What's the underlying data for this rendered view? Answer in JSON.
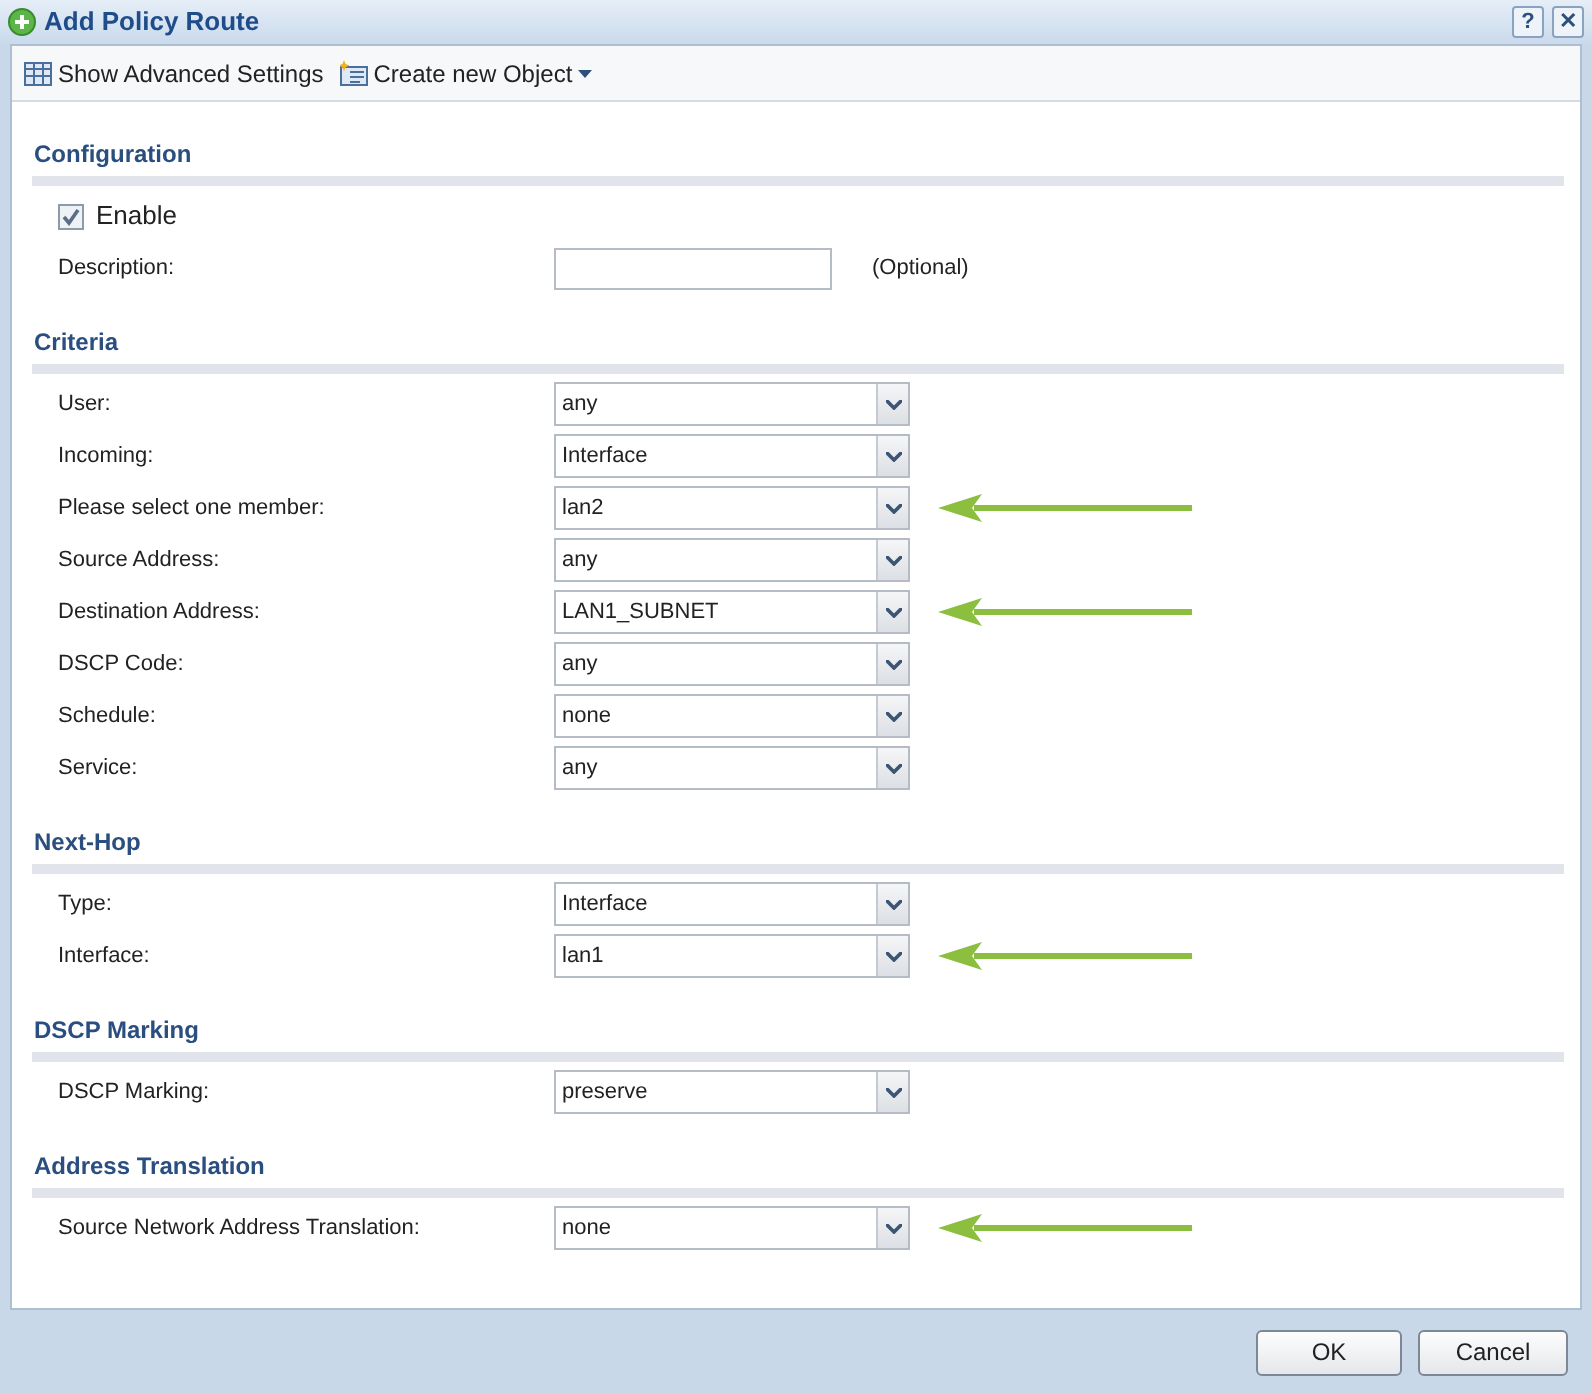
{
  "window": {
    "title": "Add Policy Route",
    "buttons": [
      "?",
      "✕"
    ]
  },
  "toolbar": [
    {
      "label": "Show Advanced Settings",
      "kind": "table"
    },
    {
      "label": "Create new Object",
      "kind": "object",
      "dropdown": true
    }
  ],
  "sections": [
    {
      "title": "Configuration",
      "rows": [
        {
          "kind": "checkbox",
          "label": "Enable",
          "checked": true
        },
        {
          "kind": "text",
          "label": "Description:",
          "hint": "(Optional)"
        }
      ]
    },
    {
      "title": "Criteria",
      "rows": [
        {
          "kind": "select",
          "label": "User:",
          "value": "any",
          "annotated": false
        },
        {
          "kind": "select",
          "label": "Incoming:",
          "value": "Interface",
          "annotated": false
        },
        {
          "kind": "select",
          "label": "Please select one member:",
          "value": "lan2",
          "annotated": true
        },
        {
          "kind": "select",
          "label": "Source Address:",
          "value": "any",
          "annotated": false
        },
        {
          "kind": "select",
          "label": "Destination Address:",
          "value": "LAN1_SUBNET",
          "annotated": true
        },
        {
          "kind": "select",
          "label": "DSCP Code:",
          "value": "any",
          "annotated": false
        },
        {
          "kind": "select",
          "label": "Schedule:",
          "value": "none",
          "annotated": false
        },
        {
          "kind": "select",
          "label": "Service:",
          "value": "any",
          "annotated": false
        }
      ]
    },
    {
      "title": "Next-Hop",
      "rows": [
        {
          "kind": "select",
          "label": "Type:",
          "value": "Interface",
          "annotated": false
        },
        {
          "kind": "select",
          "label": "Interface:",
          "value": "lan1",
          "annotated": true
        }
      ]
    },
    {
      "title": "DSCP Marking",
      "rows": [
        {
          "kind": "select",
          "label": "DSCP Marking:",
          "value": "preserve",
          "annotated": false
        }
      ]
    },
    {
      "title": "Address Translation",
      "rows": [
        {
          "kind": "select",
          "label": "Source Network Address Translation:",
          "value": "none",
          "annotated": true
        }
      ]
    }
  ],
  "footer_buttons": [
    "OK",
    "Cancel"
  ]
}
